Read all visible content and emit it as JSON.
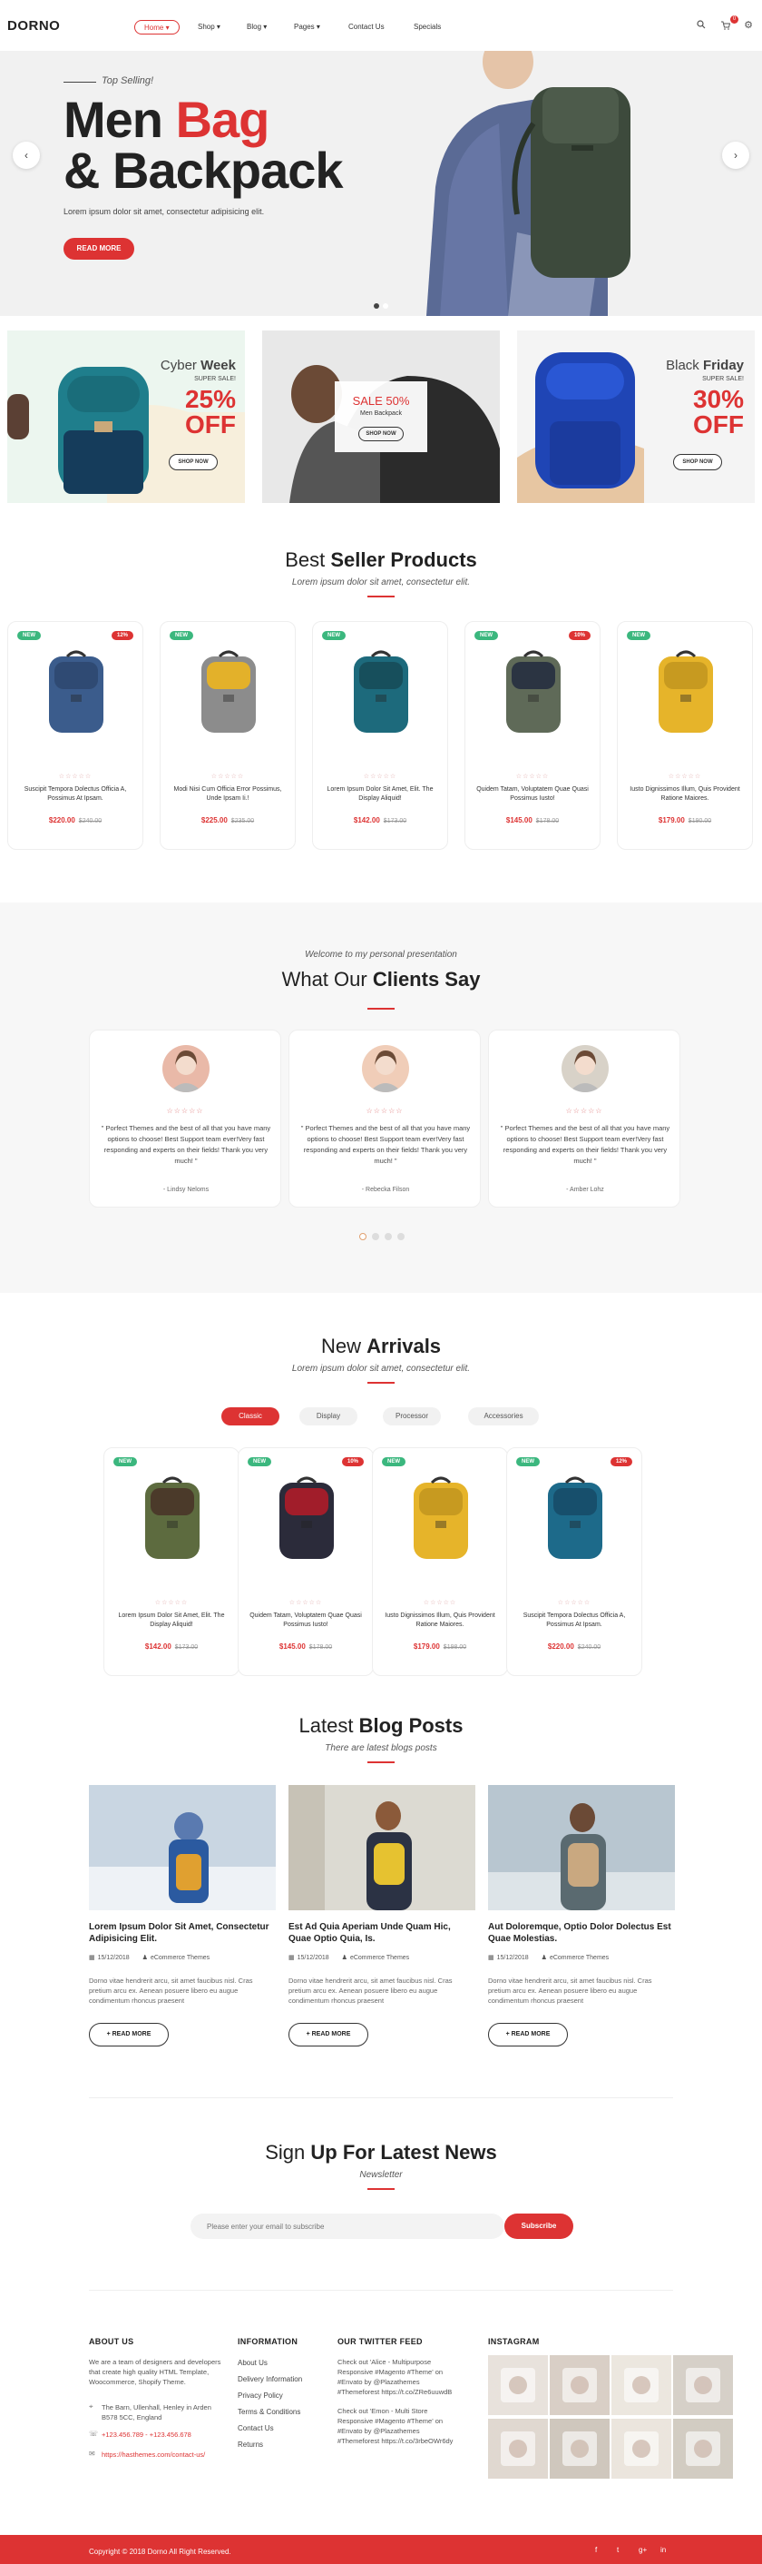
{
  "header": {
    "logo": "DORNO",
    "nav": [
      {
        "label": "Home",
        "arrow": true
      },
      {
        "label": "Shop",
        "arrow": true
      },
      {
        "label": "Blog",
        "arrow": true
      },
      {
        "label": "Pages",
        "arrow": true
      },
      {
        "label": "Contact Us",
        "arrow": false
      },
      {
        "label": "Specials",
        "arrow": false
      }
    ],
    "cart_count": "0",
    "icons": [
      "search-icon",
      "cart-icon",
      "gear-icon"
    ]
  },
  "hero": {
    "tag": "Top Selling!",
    "title_line1_a": "Men",
    "title_line1_b": "Bag",
    "title_line2": "& Backpack",
    "subtitle": "Lorem ipsum dolor sit amet, consectetur adipisicing elit.",
    "button": "READ MORE"
  },
  "banners": [
    {
      "title_a": "Cyber",
      "title_b": "Week",
      "sub": "SUPER SALE!",
      "pct": "25%",
      "off": "OFF",
      "button": "SHOP NOW"
    },
    {
      "title": "SALE 50%",
      "sub": "Men Backpack",
      "button": "SHOP NOW"
    },
    {
      "title_a": "Black",
      "title_b": "Friday",
      "sub": "SUPER SALE!",
      "pct": "30%",
      "off": "OFF",
      "button": "SHOP NOW"
    }
  ],
  "best_sellers": {
    "title_a": "Best",
    "title_b": "Seller Products",
    "subtitle": "Lorem ipsum dolor sit amet, consectetur elit.",
    "products": [
      {
        "new": "NEW",
        "off": "12%",
        "title": "Suscipit Tempora Dolectus Officia A, Possimus At Ipsam.",
        "stars": "☆☆☆☆☆",
        "price": "$220.00",
        "old": "$240.00"
      },
      {
        "new": "NEW",
        "off": "",
        "title": "Modi Nisi Cum Officia Error Possimus, Unde Ipsam Ii.!",
        "stars": "☆☆☆☆☆",
        "price": "$225.00",
        "old": "$235.00"
      },
      {
        "new": "NEW",
        "off": "",
        "title": "Lorem Ipsum Dolor Sit Amet, Elit. The Display Aliquid!",
        "stars": "☆☆☆☆☆",
        "price": "$142.00",
        "old": "$173.00"
      },
      {
        "new": "NEW",
        "off": "10%",
        "title": "Quidem Tatam, Voluptatem Quae Quasi Possimus Iusto!",
        "stars": "☆☆☆☆☆",
        "price": "$145.00",
        "old": "$178.00"
      },
      {
        "new": "NEW",
        "off": "",
        "title": "Iusto Dignissimos Illum, Quis Provident Ratione Maiores.",
        "stars": "☆☆☆☆☆",
        "price": "$179.00",
        "old": "$190.00"
      }
    ]
  },
  "testimonials": {
    "welcome": "Welcome to my personal presentation",
    "title_a": "What Our",
    "title_b": "Clients Say",
    "items": [
      {
        "stars": "☆☆☆☆☆",
        "quote": "\" Porfect Themes and the best of all that you have many options to choose! Best Support team ever!Very fast responding and experts on their fields! Thank you very much! \"",
        "name": "- Lindsy Neloms"
      },
      {
        "stars": "☆☆☆☆☆",
        "quote": "\" Porfect Themes and the best of all that you have many options to choose! Best Support team ever!Very fast responding and experts on their fields! Thank you very much! \"",
        "name": "- Rebecka Filson"
      },
      {
        "stars": "☆☆☆☆☆",
        "quote": "\" Porfect Themes and the best of all that you have many options to choose! Best Support team ever!Very fast responding and experts on their fields! Thank you very much! \"",
        "name": "- Amber Lohz"
      }
    ]
  },
  "arrivals": {
    "title_a": "New",
    "title_b": "Arrivals",
    "subtitle": "Lorem ipsum dolor sit amet, consectetur elit.",
    "tabs": [
      "Classic",
      "Display",
      "Processor",
      "Accessories"
    ],
    "products": [
      {
        "new": "NEW",
        "off": "",
        "title": "Lorem Ipsum Dolor Sit Amet, Elit. The Display Aliquid!",
        "stars": "☆☆☆☆☆",
        "price": "$142.00",
        "old": "$173.00"
      },
      {
        "new": "NEW",
        "off": "10%",
        "title": "Quidem Tatam, Voluptatem Quae Quasi Possimus Iusto!",
        "stars": "☆☆☆☆☆",
        "price": "$145.00",
        "old": "$178.00"
      },
      {
        "new": "NEW",
        "off": "",
        "title": "Iusto Dignissimos Illum, Quis Provident Ratione Maiores.",
        "stars": "☆☆☆☆☆",
        "price": "$179.00",
        "old": "$198.00"
      },
      {
        "new": "NEW",
        "off": "12%",
        "title": "Suscipit Tempora Dolectus Officia A, Possimus At Ipsam.",
        "stars": "☆☆☆☆☆",
        "price": "$220.00",
        "old": "$240.00"
      }
    ]
  },
  "blog": {
    "title_a": "Latest",
    "title_b": "Blog Posts",
    "subtitle": "There are latest blogs posts",
    "posts": [
      {
        "title": "Lorem Ipsum Dolor Sit Amet, Consectetur Adipisicing Elit.",
        "date": "15/12/2018",
        "author": "eCommerce Themes",
        "excerpt": "Dorno vitae hendrerit arcu, sit amet faucibus nisl. Cras pretium arcu ex. Aenean posuere libero eu augue condimentum rhoncus praesent",
        "button": "+ READ MORE"
      },
      {
        "title": "Est Ad Quia Aperiam Unde Quam Hic, Quae Optio Quia, Is.",
        "date": "15/12/2018",
        "author": "eCommerce Themes",
        "excerpt": "Dorno vitae hendrerit arcu, sit amet faucibus nisl. Cras pretium arcu ex. Aenean posuere libero eu augue condimentum rhoncus praesent",
        "button": "+ READ MORE"
      },
      {
        "title": "Aut Doloremque, Optio Dolor Dolectus Est Quae Molestias.",
        "date": "15/12/2018",
        "author": "eCommerce Themes",
        "excerpt": "Dorno vitae hendrerit arcu, sit amet faucibus nisl. Cras pretium arcu ex. Aenean posuere libero eu augue condimentum rhoncus praesent",
        "button": "+ READ MORE"
      }
    ]
  },
  "newsletter": {
    "title_a": "Sign",
    "title_b": "Up For Latest News",
    "subtitle": "Newsletter",
    "placeholder": "Please enter your email to subscribe",
    "button": "Subscribe"
  },
  "footer": {
    "about_title": "ABOUT US",
    "about_text": "We are a team of designers and developers that create high quality HTML Template, Woocommerce, Shopify Theme.",
    "address": "The Barn, Ullenhall, Henley in Arden B578 5CC, England",
    "phone": "+123.456.789 - +123.456.678",
    "url": "https://hasthemes.com/contact-us/",
    "info_title": "INFORMATION",
    "info_links": [
      "About Us",
      "Delivery Information",
      "Privacy Policy",
      "Terms & Conditions",
      "Contact Us",
      "Returns"
    ],
    "twitter_title": "OUR TWITTER FEED",
    "tweet1": "Check out 'Alice - Multipurpose Responsive #Magento #Theme' on #Envato by @Plazathemes #Themeforest https://t.co/ZRe6uuwdB",
    "tweet2": "Check out 'Emon - Multi Store Responsive #Magento #Theme' on #Envato by @Plazathemes #Themeforest https://t.co/3rbeOWr6dy",
    "instagram_title": "INSTAGRAM",
    "copyright": "Copyright © 2018 Dorno All Right Reserved.",
    "social": [
      "f",
      "t",
      "g+",
      "in"
    ]
  },
  "colors": {
    "accent": "#dd3333",
    "new_badge": "#3bb77e"
  }
}
